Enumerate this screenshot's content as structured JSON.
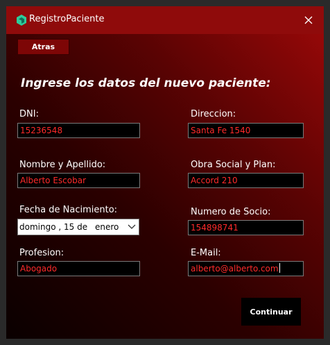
{
  "window": {
    "title": "RegistroPaciente",
    "colors": {
      "titlebar": "#8f0b0b",
      "field_text": "#ff2a2a",
      "field_bg": "#000000"
    }
  },
  "toolbar": {
    "back_label": "Atras"
  },
  "form": {
    "heading": "Ingrese los datos del nuevo paciente:",
    "dni": {
      "label": "DNI:",
      "value": "15236548"
    },
    "nombre": {
      "label": "Nombre y Apellido:",
      "value": "Alberto Escobar"
    },
    "fecha": {
      "label": "Fecha de Nacimiento:",
      "date_text": "domingo , 15 de",
      "month_text": "enero"
    },
    "profesion": {
      "label": "Profesion:",
      "value": "Abogado"
    },
    "direccion": {
      "label": "Direccion:",
      "value": "Santa Fe 1540"
    },
    "obra_social": {
      "label": "Obra Social y Plan:",
      "value": "Accord 210"
    },
    "numero_socio": {
      "label": "Numero de Socio:",
      "value": "154898741"
    },
    "email": {
      "label": "E-Mail:",
      "value": "alberto@alberto.com"
    },
    "continue_label": "Continuar"
  },
  "icons": {
    "app": "app-logo-icon",
    "close": "close-icon",
    "dropdown": "chevron-down-icon"
  }
}
